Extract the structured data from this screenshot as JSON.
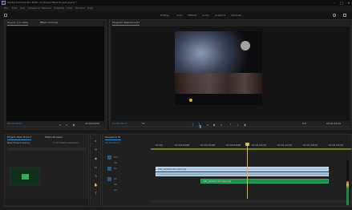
{
  "app": {
    "title": "Adobe Premiere Pro 2020 - D:\\Project\\New Project.prproj *",
    "menu": [
      "File",
      "Edit",
      "Clip",
      "Sequence",
      "Markers",
      "Graphics",
      "View",
      "Window",
      "Help"
    ],
    "window_controls": [
      "–",
      "□",
      "✕"
    ]
  },
  "workspaces": [
    "Editing",
    "Color",
    "Effects",
    "Audio",
    "Graphics",
    "Libraries"
  ],
  "source_monitor": {
    "tabs": [
      "Source: (no clips)",
      "Effect Controls"
    ],
    "timecode_left": "00;00;00;00",
    "timecode_right": "00;00;00;00"
  },
  "program_monitor": {
    "tab": "Program: Sequence 01",
    "timecode": "00;00;36;13",
    "fit": "Fit",
    "resolution": "Full",
    "duration": "00;01;52;20"
  },
  "project_panel": {
    "tabs": [
      "Project: New Project",
      "Media Browser"
    ],
    "project_file": "New Project.prproj",
    "item_count": "1 of 3 items selected"
  },
  "tools": [
    "▸",
    "⇹",
    "◆",
    "⇔",
    "✎",
    "✋",
    "T"
  ],
  "timeline": {
    "tab": "Sequence 01",
    "timecode": "00;00;36;13",
    "ruler_ticks": [
      "00;00",
      "00;00;16;00",
      "00;00;32;00",
      "00;00;48;00",
      "00;01;04;02",
      "00;01;20;02",
      "00;01;36;02",
      "00;01;52;02"
    ],
    "tracks": [
      "V3",
      "V2",
      "V1",
      "A1",
      "A2",
      "A3"
    ],
    "clips": [
      {
        "track": "V1",
        "label": "VID_20200115.mp4 [V]"
      },
      {
        "track": "A1",
        "label": "VID_20200115.mp4 [A]"
      }
    ]
  },
  "colors": {
    "panel_bg": "#202020",
    "accent": "#3a8bd6",
    "video_clip": "#a9c9e6",
    "audio_clip": "#1e8c4a",
    "playhead": "#d8b84a"
  }
}
